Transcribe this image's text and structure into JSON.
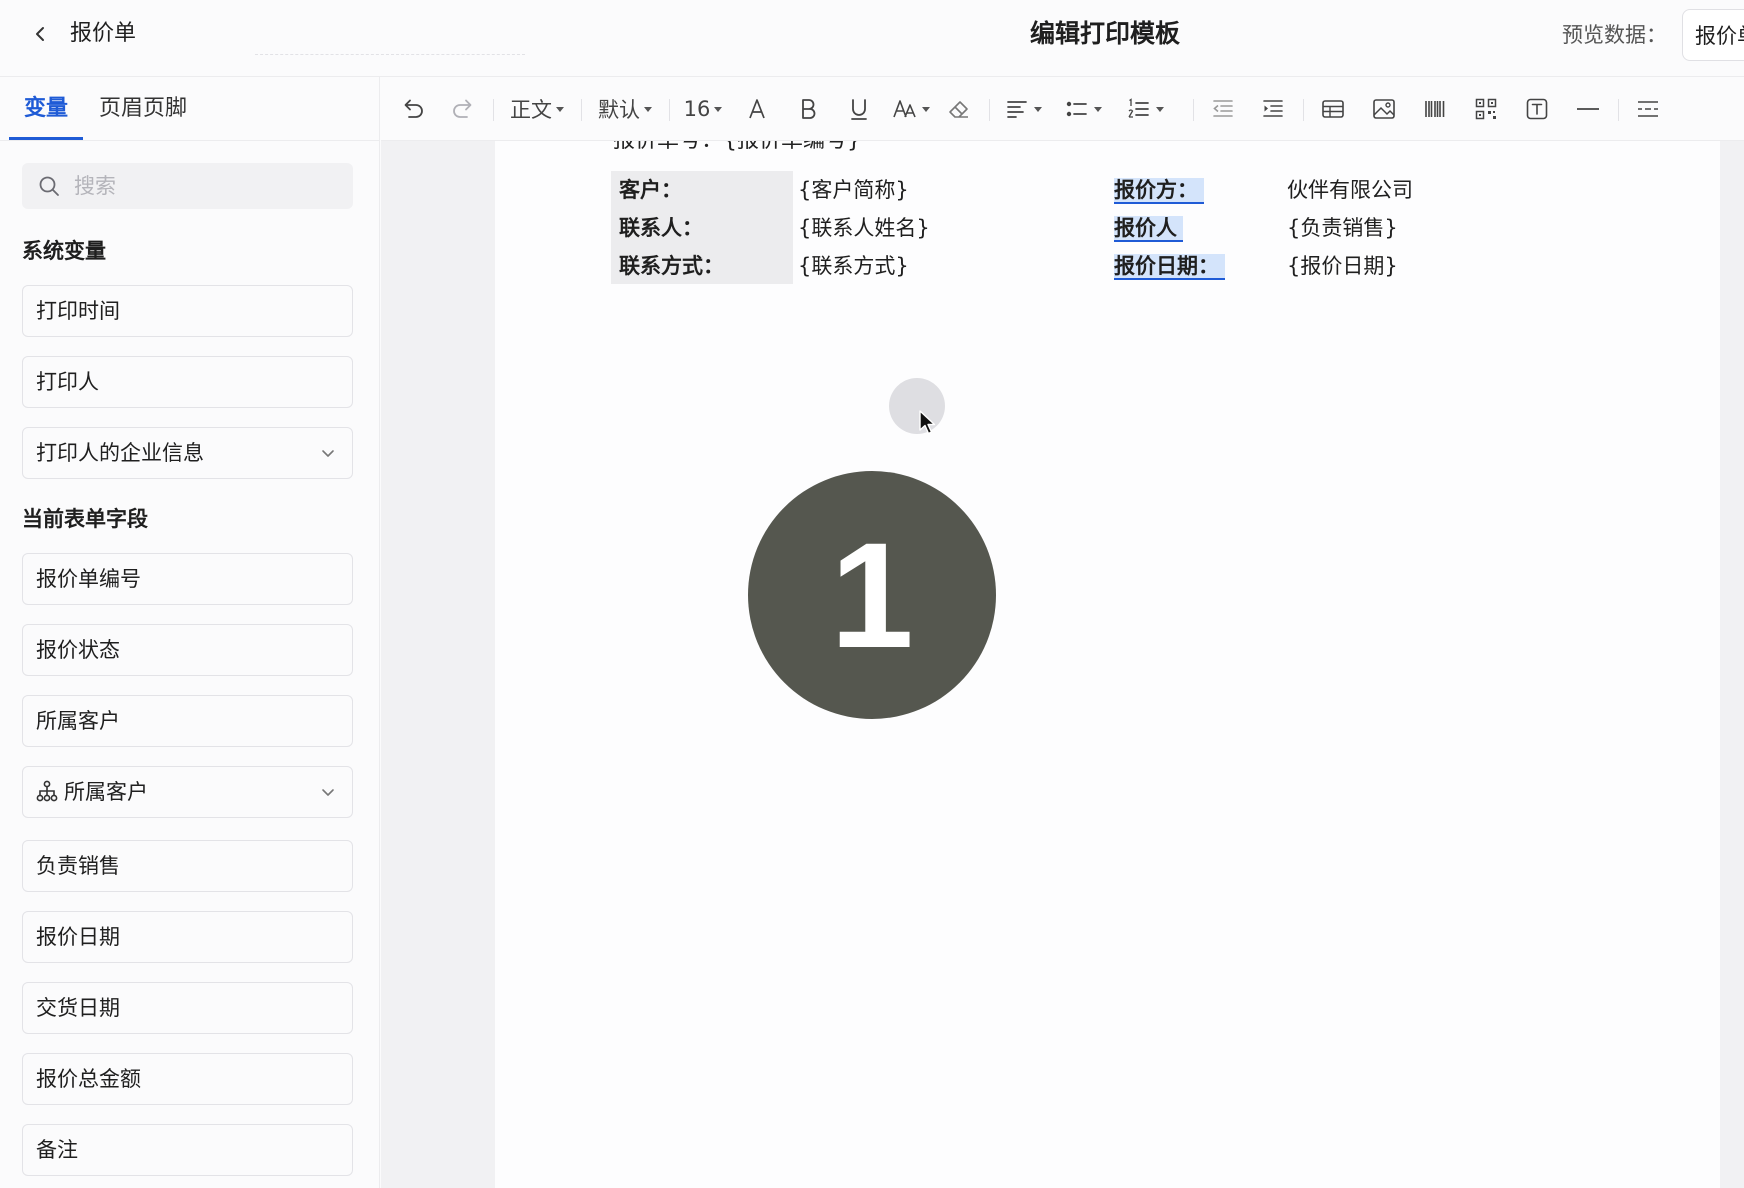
{
  "header": {
    "back_icon": "chevron-left-icon",
    "breadcrumb": "报价单",
    "title": "编辑打印模板",
    "preview_label": "预览数据：",
    "preview_value": "报价单"
  },
  "sidebar": {
    "tabs": [
      "变量",
      "页眉页脚"
    ],
    "active_tab": 0,
    "search_placeholder": "搜索",
    "sections": [
      {
        "title": "系统变量",
        "items": [
          {
            "label": "打印时间"
          },
          {
            "label": "打印人"
          },
          {
            "label": "打印人的企业信息",
            "expandable": true
          }
        ]
      },
      {
        "title": "当前表单字段",
        "items": [
          {
            "label": "报价单编号"
          },
          {
            "label": "报价状态"
          },
          {
            "label": "所属客户"
          },
          {
            "label": "所属客户",
            "expandable": true,
            "icon": "relation-tree-icon"
          },
          {
            "label": "负责销售"
          },
          {
            "label": "报价日期"
          },
          {
            "label": "交货日期"
          },
          {
            "label": "报价总金额"
          },
          {
            "label": "备注"
          }
        ]
      }
    ]
  },
  "toolbar": {
    "paragraph_style": "正文",
    "font_family": "默认",
    "font_size": "16",
    "icons": [
      "undo-icon",
      "redo-icon",
      "font-color-icon",
      "bold-icon",
      "underline-icon",
      "font-size-adjust-icon",
      "clear-format-icon",
      "align-icon",
      "bulleted-list-icon",
      "numbered-list-icon",
      "outdent-icon",
      "indent-icon",
      "table-icon",
      "image-icon",
      "barcode-icon",
      "qrcode-icon",
      "text-box-icon",
      "horizontal-line-icon",
      "page-break-icon"
    ]
  },
  "document": {
    "heading": "报价单号：{报价单编号}",
    "rows": [
      {
        "label1": "客户：",
        "value1": "{客户简称}",
        "label2": "报价方：",
        "value2": "伙伴有限公司"
      },
      {
        "label1": "联系人：",
        "value1": "{联系人姓名}",
        "label2": "报价人",
        "value2": "{负责销售}"
      },
      {
        "label1": "联系方式：",
        "value1": "{联系方式}",
        "label2": "报价日期：",
        "value2": "{报价日期}"
      }
    ]
  },
  "overlay": {
    "step_number": "1",
    "badge_color": "#55574f"
  },
  "colors": {
    "accent": "#1f5bd6",
    "highlight": "#d4e4fb"
  }
}
